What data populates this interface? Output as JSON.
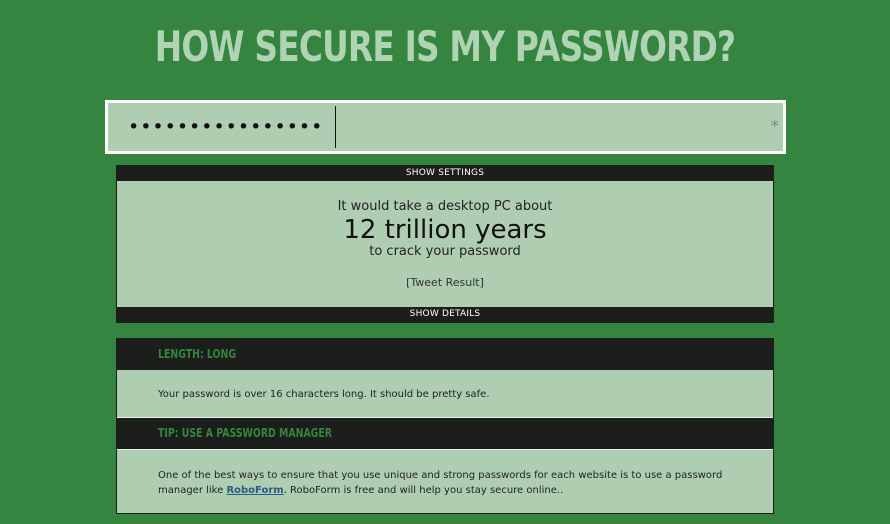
{
  "header": {
    "title": "HOW SECURE IS MY PASSWORD?"
  },
  "password": {
    "masked_value": "••••••••••••••••",
    "toggle_symbol": "*"
  },
  "settings": {
    "label": "SHOW SETTINGS"
  },
  "result": {
    "pre_text": "It would take a desktop PC about",
    "time": "12 trillion years",
    "post_text": "to crack your password",
    "tweet_label": "[Tweet Result]"
  },
  "details_toggle": {
    "label": "SHOW DETAILS"
  },
  "details": {
    "length_heading": "LENGTH: LONG",
    "length_text": "Your password is over 16 characters long. It should be pretty safe.",
    "tip_heading": "TIP: USE A PASSWORD MANAGER",
    "tip_text_before": "One of the best ways to ensure that you use unique and strong passwords for each website is to use a password manager like ",
    "tip_link": "RoboForm",
    "tip_text_after": ". RoboForm is free and will help you stay secure online.."
  },
  "colors": {
    "background": "#35843f",
    "panel": "#afcdb1",
    "bar": "#1b1e1b",
    "heading_text": "#35843f",
    "link": "#2b5a86"
  }
}
